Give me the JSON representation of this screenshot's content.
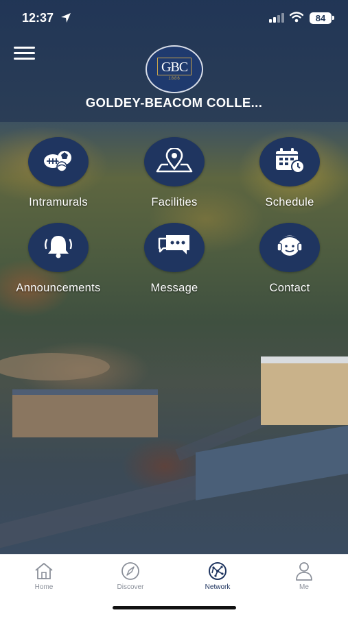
{
  "status_bar": {
    "time": "12:37",
    "battery": "84",
    "location_icon": "location-arrow-icon",
    "signal_icon": "cellular-signal-icon",
    "wifi_icon": "wifi-icon"
  },
  "header": {
    "menu_icon": "hamburger-menu-icon",
    "logo": {
      "text": "GBC",
      "year": "1886"
    },
    "title": "GOLDEY-BEACOM COLLE..."
  },
  "tiles": [
    {
      "label": "Intramurals",
      "icon": "sports-balls-icon"
    },
    {
      "label": "Facilities",
      "icon": "map-pin-icon"
    },
    {
      "label": "Schedule",
      "icon": "calendar-clock-icon"
    },
    {
      "label": "Announcements",
      "icon": "bell-icon"
    },
    {
      "label": "Message",
      "icon": "chat-bubbles-icon"
    },
    {
      "label": "Contact",
      "icon": "headset-agent-icon"
    }
  ],
  "tabbar": {
    "tabs": [
      {
        "label": "Home",
        "icon": "home-icon",
        "active": false
      },
      {
        "label": "Discover",
        "icon": "compass-icon",
        "active": false
      },
      {
        "label": "Network",
        "icon": "network-globe-icon",
        "active": true
      },
      {
        "label": "Me",
        "icon": "person-icon",
        "active": false
      }
    ]
  },
  "colors": {
    "brand_navy": "#1f3560",
    "tab_active": "#1f3560",
    "tab_inactive": "#8a8f99",
    "logo_gold": "#c9a44a"
  }
}
